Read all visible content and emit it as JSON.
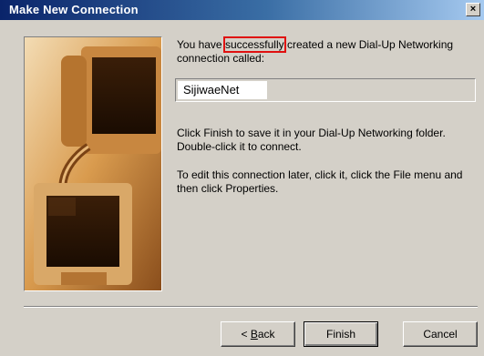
{
  "window": {
    "title": "Make New Connection",
    "close_label": "×"
  },
  "intro": {
    "text_before": "You have ",
    "highlighted": "successfully",
    "text_after": " created a new Dial-Up Networking connection called:"
  },
  "connection_name": "SijiwaeNet",
  "instructions": [
    "Click Finish to save it in your Dial-Up Networking folder. Double-click it to connect.",
    "To edit this connection later, click it, click the File menu and then click Properties."
  ],
  "buttons": {
    "back_prefix": "< ",
    "back_accel": "B",
    "back_rest": "ack",
    "finish": "Finish",
    "cancel": "Cancel"
  },
  "colors": {
    "title_gradient_start": "#0a246a",
    "highlight_border": "#e01010",
    "dialog_face": "#d4d0c8",
    "art_tone": "#c98a3c"
  },
  "icons": {
    "artwork": "computer-monitors-illustration"
  }
}
